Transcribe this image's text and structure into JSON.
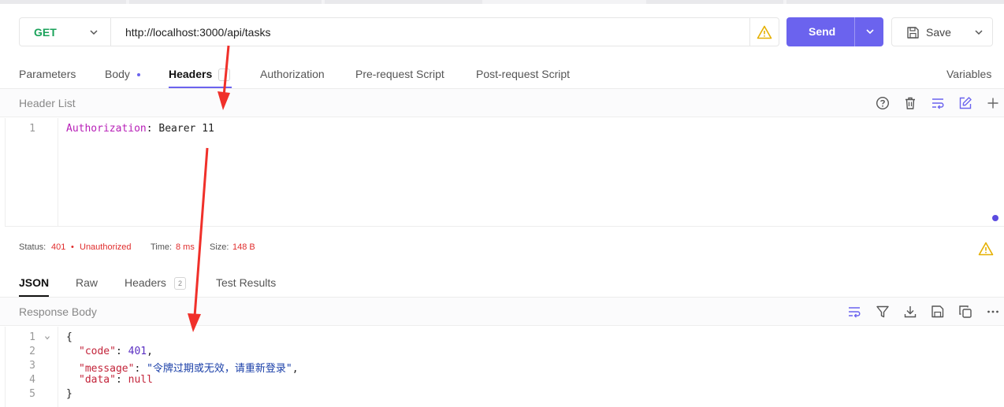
{
  "request": {
    "method": "GET",
    "url": "http://localhost:3000/api/tasks",
    "send_label": "Send",
    "save_label": "Save"
  },
  "request_tabs": {
    "parameters": "Parameters",
    "body": "Body",
    "headers": "Headers",
    "authorization": "Authorization",
    "pre_request": "Pre-request Script",
    "post_request": "Post-request Script",
    "variables": "Variables"
  },
  "header_list": {
    "title": "Header List",
    "lines": [
      {
        "num": "1",
        "key": "Authorization",
        "sep": ": ",
        "value": "Bearer 11"
      }
    ]
  },
  "status": {
    "status_label": "Status:",
    "status_code": "401",
    "bullet": "•",
    "status_text": "Unauthorized",
    "time_label": "Time:",
    "time_value": "8 ms",
    "size_label": "Size:",
    "size_value": "148 B"
  },
  "response_tabs": {
    "json": "JSON",
    "raw": "Raw",
    "headers": "Headers",
    "headers_count": "2",
    "test_results": "Test Results"
  },
  "response_body": {
    "title": "Response Body",
    "line_numbers": [
      "1",
      "2",
      "3",
      "4",
      "5"
    ],
    "open_brace": "{",
    "close_brace": "}",
    "code_key": "\"code\"",
    "code_value": "401",
    "message_key": "\"message\"",
    "message_value": "\"令牌过期或无效，请重新登录\"",
    "data_key": "\"data\"",
    "data_value": "null"
  },
  "colors": {
    "accent": "#6b63ee",
    "method_get": "#1aa25a",
    "error": "#e02d2d",
    "warning": "#e5b000",
    "annotation_arrow": "#f0302a"
  },
  "icons": {
    "method_chevron": "chevron-down-icon",
    "url_warning": "warning-icon",
    "save": "save-icon",
    "help": "help-circle-icon",
    "delete": "trash-icon",
    "wrap": "wrap-lines-icon",
    "edit": "edit-icon",
    "add": "plus-icon",
    "filter": "filter-icon",
    "download": "download-icon",
    "copy": "copy-icon",
    "more": "more-horizontal-icon"
  }
}
